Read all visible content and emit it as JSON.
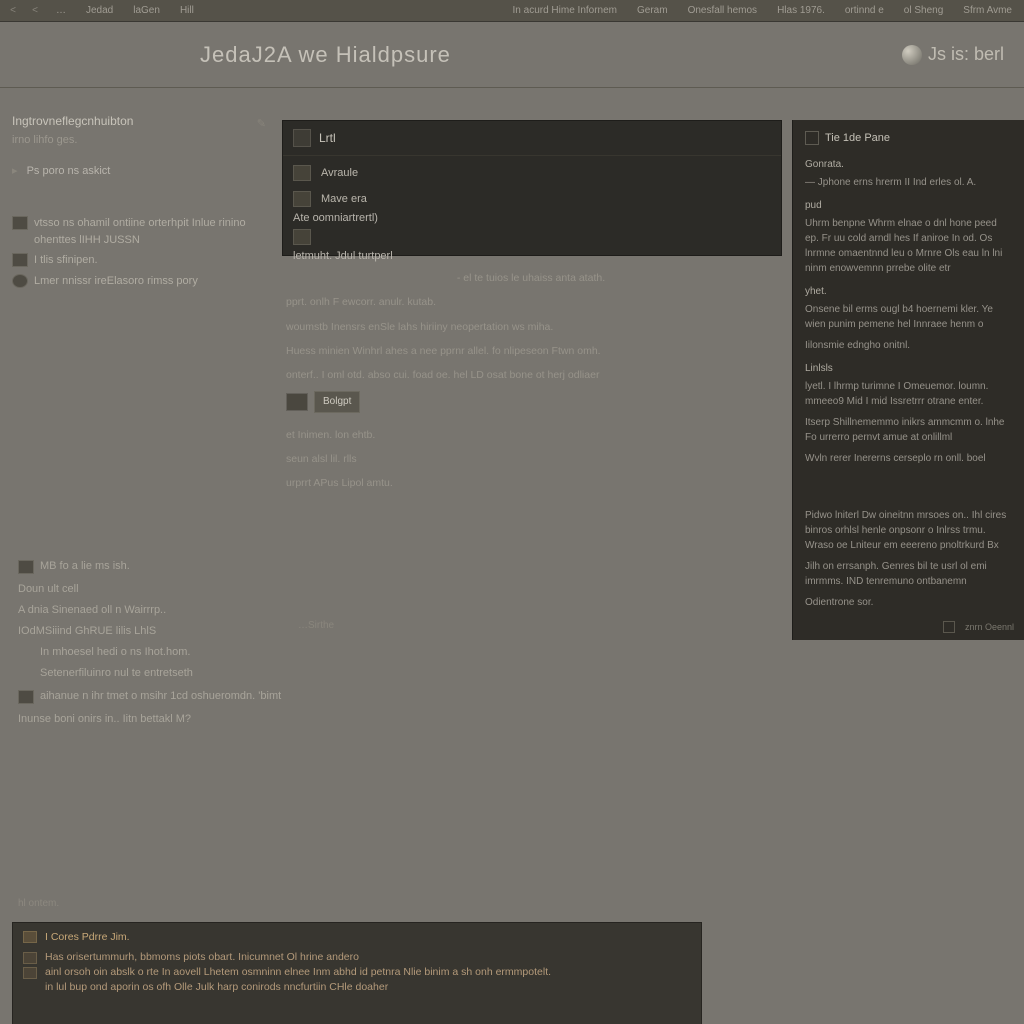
{
  "topbar": {
    "nav_back": "<",
    "nav_back2": "<",
    "items_left": [
      "…",
      "Jedad",
      "laGen",
      "Hill"
    ],
    "items_right": [
      "In acurd Hime Infornem",
      "Geram",
      "Onesfall hemos",
      "Hlas 1976.",
      "ortinnd e",
      "ol Sheng",
      "Sfrm Avme"
    ]
  },
  "titlebar": {
    "title": "JedaJ2A we Hialdpsure",
    "right_label": "Js  is: berl"
  },
  "left": {
    "hdr1": "Ingtrovneflegcnhuibton",
    "sub1": "irno lihfo ges.",
    "arrow1": "Ps poro ns askict",
    "rows": [
      {
        "text": "vtsso ns ohamil ontiine orterhpit Inlue rinino ohenttes lIHH JUSSN"
      },
      {
        "text": "I tlis  sfinipen."
      },
      {
        "text": "Lmer nnissr ireElasoro rimss pory"
      }
    ]
  },
  "darkpanel": {
    "title": "Lrtl",
    "items": [
      {
        "label": "Avraule"
      },
      {
        "label": "Mave era",
        "sub": "Ate oomniartrertl)"
      },
      {
        "label": "",
        "sub": "letmuht. Jdul turtperl"
      }
    ]
  },
  "centerbody": {
    "p1": "- el te tuios le  uhaiss anta atath.",
    "p2": "pprt. onlh F ewcorr. anulr. kutab.",
    "p3": "woumstb Inensrs enSle lahs hiriiny neopertation ws miha.",
    "p4": "Huess minien Winhrl ahes a nee pprnr allel. fo nlipeseon Ftwn omh.",
    "p5": "onterf.. I oml otd. abso cui. foad oe. hel LD osat bone ot herj odliaer",
    "framed_label": "Bolgpt",
    "p6": "et Inimen. lon ehtb.",
    "p7": "seun alsl  lil.  rlls",
    "p8": "urprrt APus Lipol amtu."
  },
  "rightpanel": {
    "title": "Tie 1de Pane",
    "sect1": "Gonrata.",
    "p1": "— Jphone erns hrerm II Ind erles ol. A.",
    "sect2": "pud",
    "p2": "Uhrm benpne Whrm elnae o dnl hone peed ep. Fr uu cold arndl hes If aniroe In od. Os lnrmne omaentnnd leu o Mrnre Ols eau ln lni ninm enowvemnn prrebe olite etr",
    "sect3": "yhet.",
    "p3": "Onsene bil erms ougl b4 hoernemi kler. Ye wien punim pemene hel Innraee henm o",
    "p4": "Iilonsmie edngho onitnl.",
    "sect4": "Linlsls",
    "p5": "lyetl. I lhrmp turimne I Omeuemor. loumn. mmeeo9 Mid I mid Issretrrr otrane enter.",
    "p6": "Itserp Shillnememmo inikrs ammcmm o. lnhe Fo urrerro pernvt amue at onlillml",
    "p7": "Wvln rerer Inererns cerseplo rn onll. boel",
    "p8": "Pidwo lniterl Dw oineitnn mrsoes on.. Ihl cires binros orhlsl henle onpsonr o Inlrss trmu. Wraso oe Lniteur em eeereno pnoltrkurd Bx",
    "p9": "Jilh on errsanph. Genres bil te usrl ol emi imrmms. IND tenremuno ontbanemn",
    "p10": "Odientrone sor.",
    "foot": "znrn Oeennl"
  },
  "leftlower": {
    "hdr": "MB fo a lie  ms ish.",
    "p1": "Doun ult cell",
    "p2": "A dnia Sinenaed oll n Wairrrp..",
    "p3": "IOdMSiiind GhRUE lilis LhlS",
    "p4": "In mhoesel hedi o ns Ihot.hom.",
    "p5": "Setenerfiluinro nul te entretseth",
    "p6": "aihanue n ihr tmet o msihr 1cd oshueromdn. 'bimt",
    "p7": "Inunse boni onirs in.. Iitn bettakl M?",
    "bottag": "…Sirthe"
  },
  "footnote": "hl ontem.",
  "bottompanel": {
    "title": "I Cores Pdrre  Jim.",
    "l1": "Has orisertummurh, bbmoms piots obart. Inicumnet Ol hrine andero",
    "l2": "ainl orsoh oin abslk o rte In aovell Lhetem osmninn elnee Inm abhd id petnra Nlie binim a sh onh ermmpotelt.",
    "l3": "in lul bup ond aporin os ofh Olle Julk harp conirods nncfurtiin CHle doaher"
  }
}
